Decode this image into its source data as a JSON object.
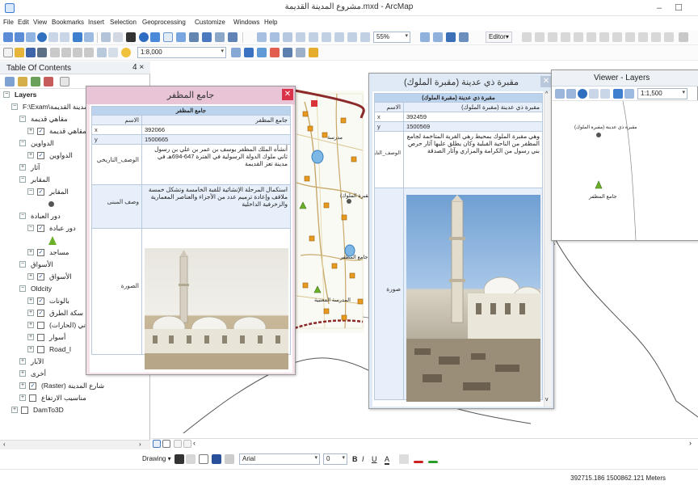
{
  "window": {
    "title": "مشروع المدينة القديمة.mxd - ArcMap",
    "controls": {
      "minimize": "–",
      "maximize": "☐"
    }
  },
  "menu": [
    "File",
    "Edit",
    "View",
    "Bookmarks",
    "Insert",
    "Selection",
    "Geoprocessing",
    "Customize",
    "Windows",
    "Help"
  ],
  "toolbar": {
    "zoom_percent": "55%",
    "editor_label": "Editor▾",
    "scale_value": "1:8,000",
    "font_name": "Arial",
    "font_size": "0"
  },
  "draw_toolbar": {
    "drawing_label": "Drawing ▾",
    "bold": "B",
    "italic": "I",
    "underline": "U",
    "font_a": "A"
  },
  "toc": {
    "title": "Table Of Contents",
    "pin": "4 ×",
    "rows": [
      {
        "indent": 0,
        "expander": "⊟",
        "text": "Layers",
        "check": null,
        "bold": true
      },
      {
        "indent": 1,
        "expander": "⊟",
        "text": "F:\\Exam\\مشروع المدينة القديمة",
        "check": null
      },
      {
        "indent": 2,
        "expander": "⊟",
        "text": "مقاهي قديمة",
        "check": null
      },
      {
        "indent": 3,
        "expander": "⊞",
        "text": "مقاهي قديمة",
        "check": "✓"
      },
      {
        "indent": 2,
        "expander": "⊟",
        "text": "الدواوين",
        "check": null
      },
      {
        "indent": 3,
        "expander": "⊞",
        "text": "الدواوين",
        "check": "✓"
      },
      {
        "indent": 2,
        "expander": "⊞",
        "text": "آثار",
        "check": null
      },
      {
        "indent": 2,
        "expander": "⊟",
        "text": "المقابر",
        "check": null
      },
      {
        "indent": 3,
        "expander": "⊟",
        "text": "المقابر",
        "check": "✓"
      },
      {
        "indent": 4,
        "expander": null,
        "text": "",
        "check": null,
        "symbol": "circle"
      },
      {
        "indent": 2,
        "expander": "⊟",
        "text": "دور العبادة",
        "check": null
      },
      {
        "indent": 3,
        "expander": "⊟",
        "text": "دور عبادة",
        "check": "✓"
      },
      {
        "indent": 4,
        "expander": null,
        "text": "",
        "check": null,
        "symbol": "tower"
      },
      {
        "indent": 3,
        "expander": "⊞",
        "text": "مساجد",
        "check": "✓"
      },
      {
        "indent": 2,
        "expander": "⊟",
        "text": "الأسواق",
        "check": null
      },
      {
        "indent": 3,
        "expander": "⊞",
        "text": "الأسواق",
        "check": "✓"
      },
      {
        "indent": 2,
        "expander": "⊟",
        "text": "Oldcity",
        "check": null
      },
      {
        "indent": 3,
        "expander": "⊞",
        "text": "بالونات",
        "check": "✓"
      },
      {
        "indent": 3,
        "expander": "⊞",
        "text": "سكة الطرق",
        "check": "✓"
      },
      {
        "indent": 3,
        "expander": "⊞",
        "text": "المباني (الحارات)",
        "check": ""
      },
      {
        "indent": 3,
        "expander": "⊞",
        "text": "أسوار",
        "check": ""
      },
      {
        "indent": 3,
        "expander": "⊞",
        "text": "Road_l",
        "check": ""
      },
      {
        "indent": 2,
        "expander": "⊞",
        "text": "الآبار",
        "check": null
      },
      {
        "indent": 2,
        "expander": "⊞",
        "text": "أخرى",
        "check": null
      },
      {
        "indent": 2,
        "expander": "⊞",
        "text": "(Raster) شارع المدينة",
        "check": "✓"
      },
      {
        "indent": 2,
        "expander": "⊞",
        "text": "مناسيب الارتفاع",
        "check": ""
      },
      {
        "indent": 1,
        "expander": "⊞",
        "text": "DamTo3D",
        "check": ""
      }
    ]
  },
  "popup_mosque": {
    "title": "جامع المظفر",
    "header": "جامع المظفر",
    "fields": [
      {
        "name": "الاسم",
        "value": "جامع المظفر"
      },
      {
        "name": "x",
        "value": "392066"
      },
      {
        "name": "y",
        "value": "1500665"
      },
      {
        "name": "الوصف_التاريخي",
        "value": "أنشأه الملك المظفر يوسف بن عمر بن علي بن رسول ثاني ملوك الدولة الرسولية في الفترة 647-694هـ في مدينة تعز القديمة"
      },
      {
        "name": "وصف المبنى",
        "value": "استكمال المرحلة الإنشائية للقبة الخامسة وتشكل خمسة ملاقف وإعادة ترميم عدد من الأجزاء والعناصر المعمارية والزخرفية الداخلية"
      },
      {
        "name": "الصورة",
        "value": ""
      }
    ]
  },
  "popup_tomb": {
    "title": "مقبرة ذي عدينة (مقبرة الملوك)",
    "header": "(مقبرة ذي عدينة (مقبرة الملوك",
    "fields": [
      {
        "name": "الاسم",
        "value": "مقبرة ذي عدينة (مقبرة الملوك)"
      },
      {
        "name": "x",
        "value": "392459"
      },
      {
        "name": "y",
        "value": "1500569"
      },
      {
        "name": "الوصف_التاريخي",
        "value": "وهي مقبرة الملوك بمحيط رهي القرية المتاخمة لجامع المظفر من الناحية القبلية وكان يطلق عليها آثار حرص بني رسول من الكرامة والمزاري وآثار الصدقة"
      },
      {
        "name": "صورة",
        "value": ""
      }
    ]
  },
  "viewer": {
    "title": "Viewer - Layers",
    "scale": "1:1,500",
    "label_tomb": "مقبرة ذي عدينة (مقبرة الملوك)",
    "label_mosque": "جامع المظفر"
  },
  "map_labels": [
    {
      "text": "مقبرة ذي عدينة (مقبرة الملوك)",
      "kind": "point"
    },
    {
      "text": "المدرسة المعتبية",
      "kind": "point"
    },
    {
      "text": "مدرسة",
      "kind": "point"
    },
    {
      "text": "جامع المظفر",
      "kind": "point"
    }
  ],
  "status": {
    "coords": "392715.186  1500862.121 Meters"
  },
  "colors": {
    "popup_title_bg": "#e8c4d6",
    "popup_title_bg2": "#dfeaf6",
    "close_red": "#d9334a",
    "header_blue": "#bcd3ee",
    "road": "#c9a96a",
    "river": "#8c2a2a",
    "marker_orange": "#e89a1e",
    "marker_green": "#6ab02a"
  },
  "icons": [
    "app-icon",
    "close-icon",
    "pan-icon",
    "zoom-in-icon",
    "zoom-out-icon",
    "identify-icon",
    "layer-icon",
    "checkbox-icon",
    "tower-icon"
  ]
}
